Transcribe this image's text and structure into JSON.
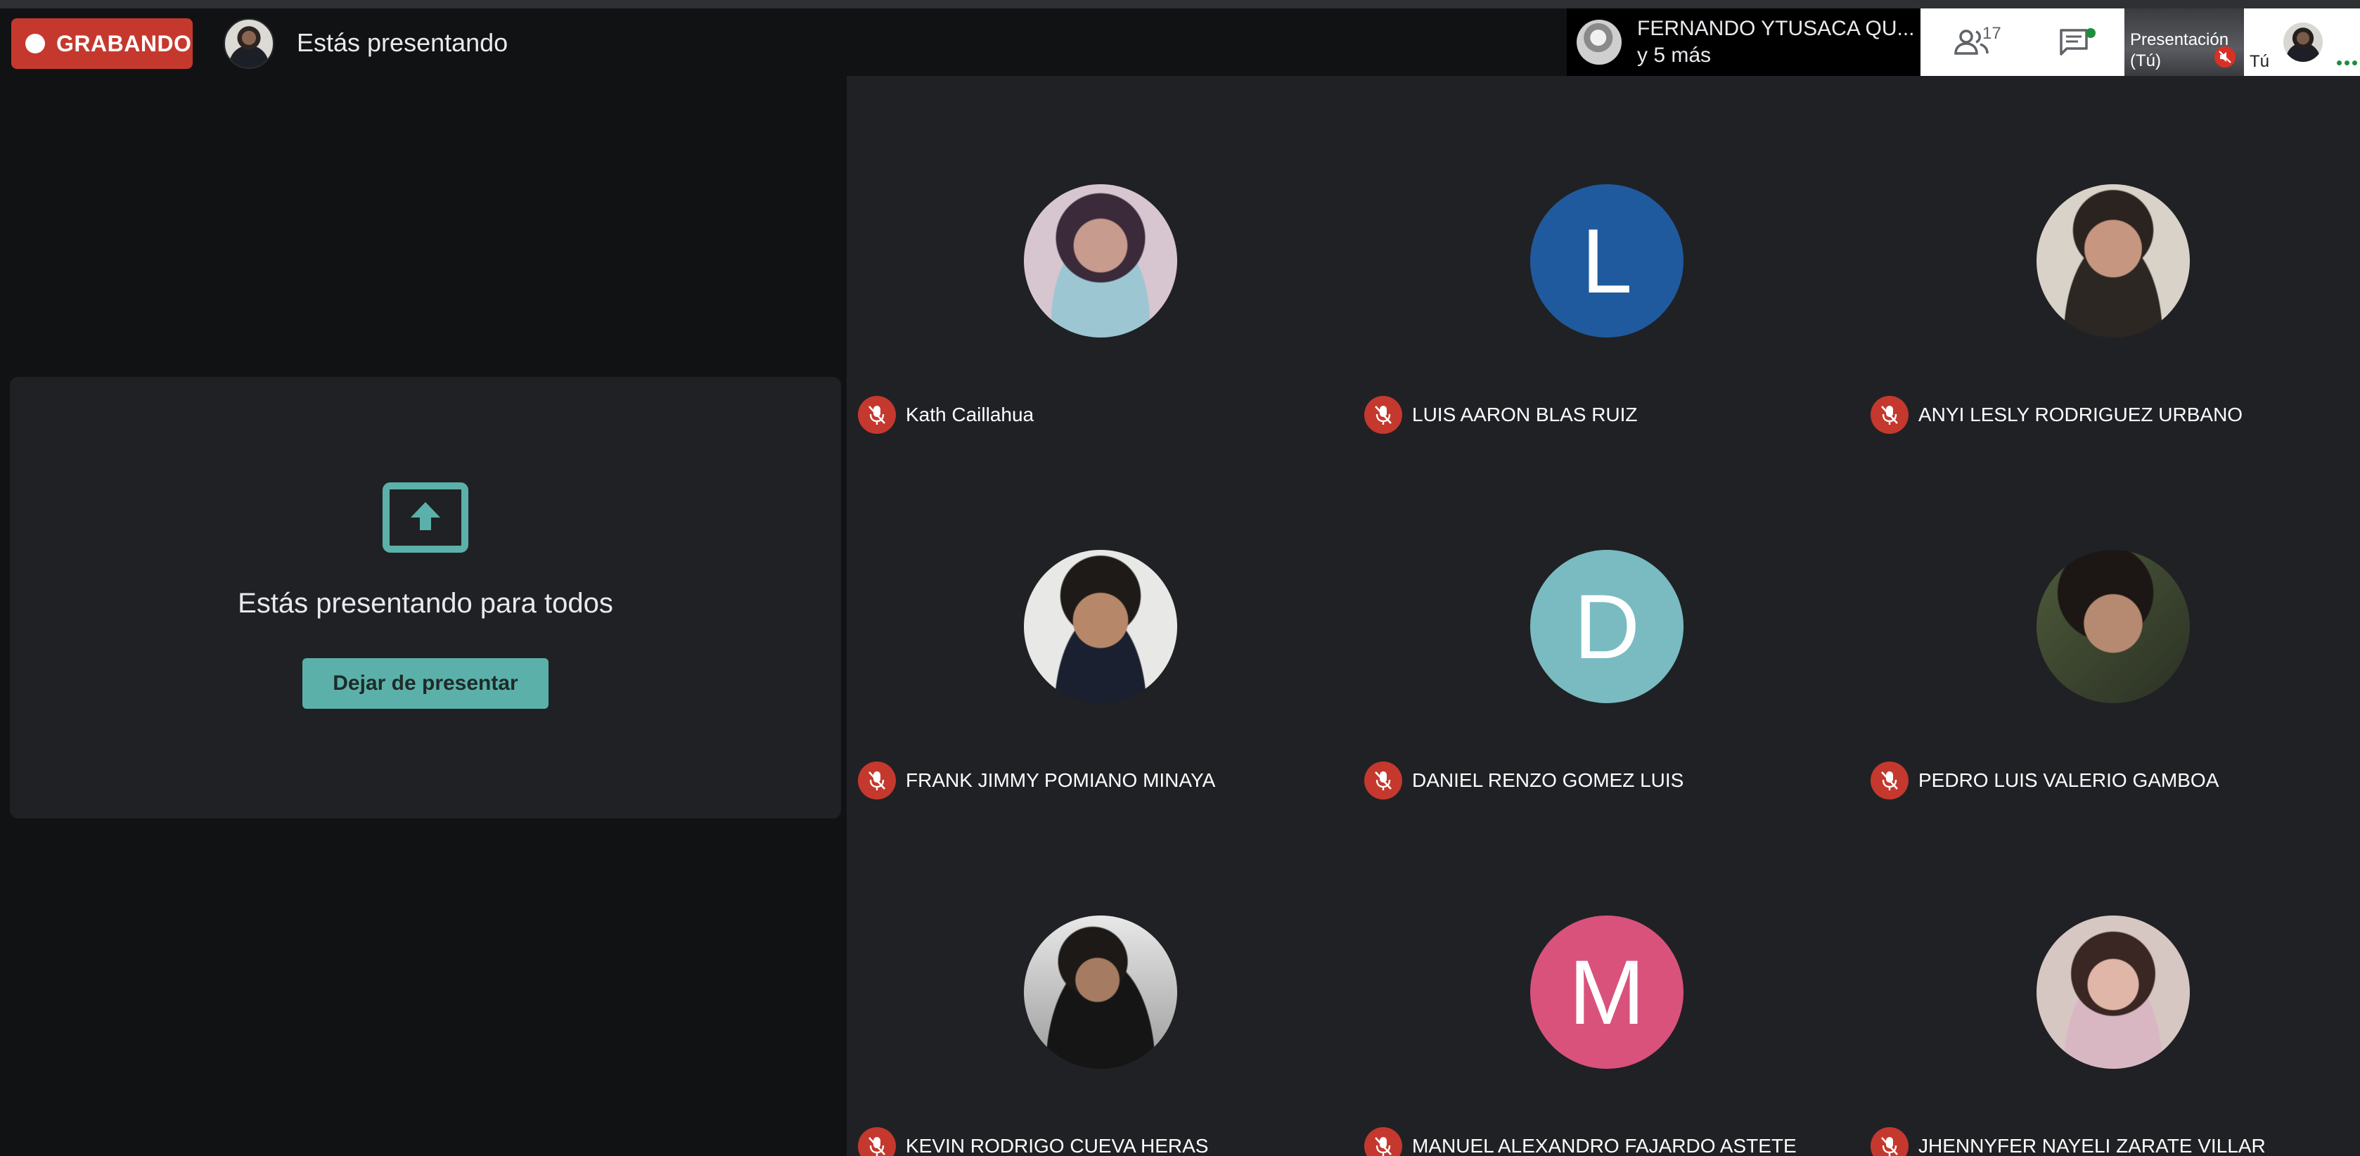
{
  "recording": {
    "label": "GRABANDO",
    "color": "#c5382e"
  },
  "header": {
    "title": "Estás presentando"
  },
  "featured_speaker": {
    "name": "FERNANDO YTUSACA QU...",
    "more": "y 5 más"
  },
  "toolbar": {
    "participant_count": "17",
    "people_icon": "people-icon",
    "chat_icon": "chat-icon"
  },
  "mini_tiles": {
    "presentation_label": "Presentación",
    "presentation_owner": "(Tú)",
    "self_label": "Tú"
  },
  "presenting_panel": {
    "message": "Estás presentando para todos",
    "stop_button": "Dejar de presentar",
    "icon": "present-screen-icon",
    "accent_color": "#5bb1a9"
  },
  "participants": [
    {
      "name": "Kath Caillahua",
      "avatar": "photo",
      "mic": "muted"
    },
    {
      "name": "LUIS AARON BLAS RUIZ",
      "avatar_letter": "L",
      "avatar_color": "#1f5a9e",
      "mic": "muted"
    },
    {
      "name": "ANYI LESLY RODRIGUEZ URBANO",
      "avatar": "photo",
      "mic": "muted"
    },
    {
      "name": "FRANK JIMMY POMIANO MINAYA",
      "avatar": "photo",
      "mic": "muted"
    },
    {
      "name": "DANIEL RENZO GOMEZ LUIS",
      "avatar_letter": "D",
      "avatar_color": "#79bbc1",
      "mic": "muted"
    },
    {
      "name": "PEDRO LUIS VALERIO GAMBOA",
      "avatar": "photo",
      "mic": "muted"
    },
    {
      "name": "KEVIN RODRIGO CUEVA HERAS",
      "avatar": "photo",
      "mic": "muted"
    },
    {
      "name": "MANUEL ALEXANDRO FAJARDO ASTETE",
      "avatar_letter": "M",
      "avatar_color": "#d9527c",
      "mic": "muted"
    },
    {
      "name": "JHENNYFER NAYELI ZARATE VILLAR",
      "avatar": "photo",
      "mic": "muted"
    }
  ]
}
